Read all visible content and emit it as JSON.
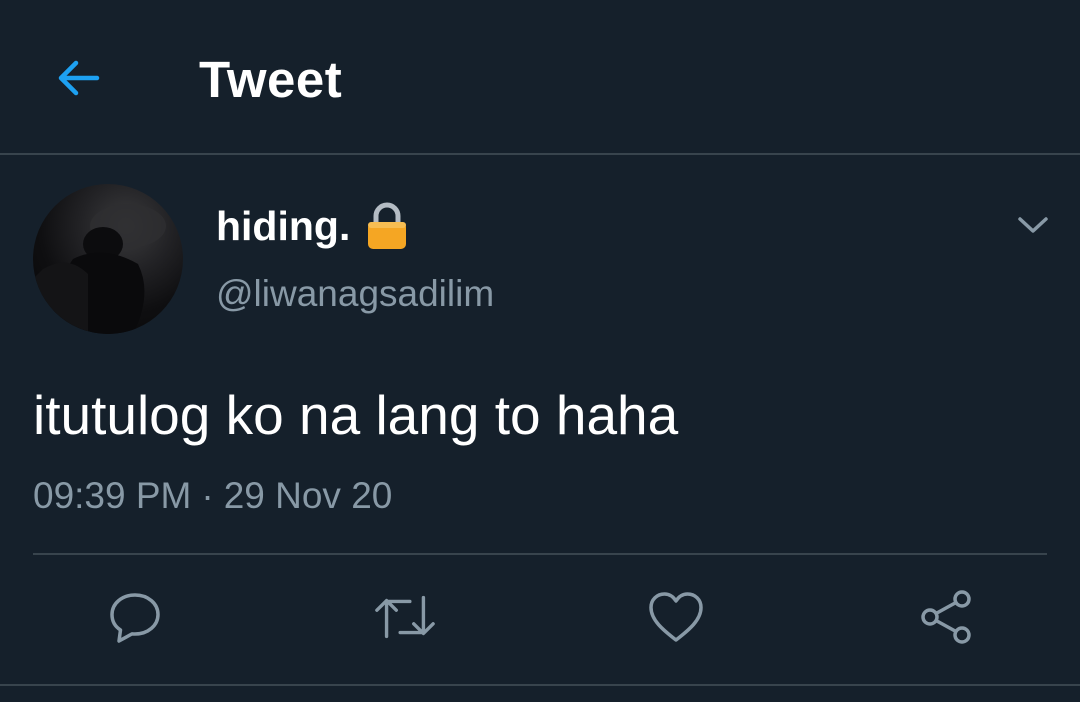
{
  "header": {
    "title": "Tweet",
    "back_icon": "arrow-left-icon"
  },
  "tweet": {
    "author": {
      "display_name": "hiding.",
      "handle": "@liwanagsadilim",
      "protected_icon": "lock-icon"
    },
    "text": "itutulog ko na lang to haha",
    "time": "09:39 PM",
    "separator": "·",
    "date": "29 Nov 20",
    "more_icon": "chevron-down-icon"
  },
  "actions": [
    {
      "name": "reply",
      "icon": "reply-icon"
    },
    {
      "name": "retweet",
      "icon": "retweet-icon"
    },
    {
      "name": "like",
      "icon": "heart-icon"
    },
    {
      "name": "share",
      "icon": "share-icon"
    }
  ],
  "colors": {
    "background": "#15202b",
    "accent": "#1da1f2",
    "secondary_text": "#8899a6",
    "divider": "#38444d",
    "lock": "#f5a623"
  }
}
